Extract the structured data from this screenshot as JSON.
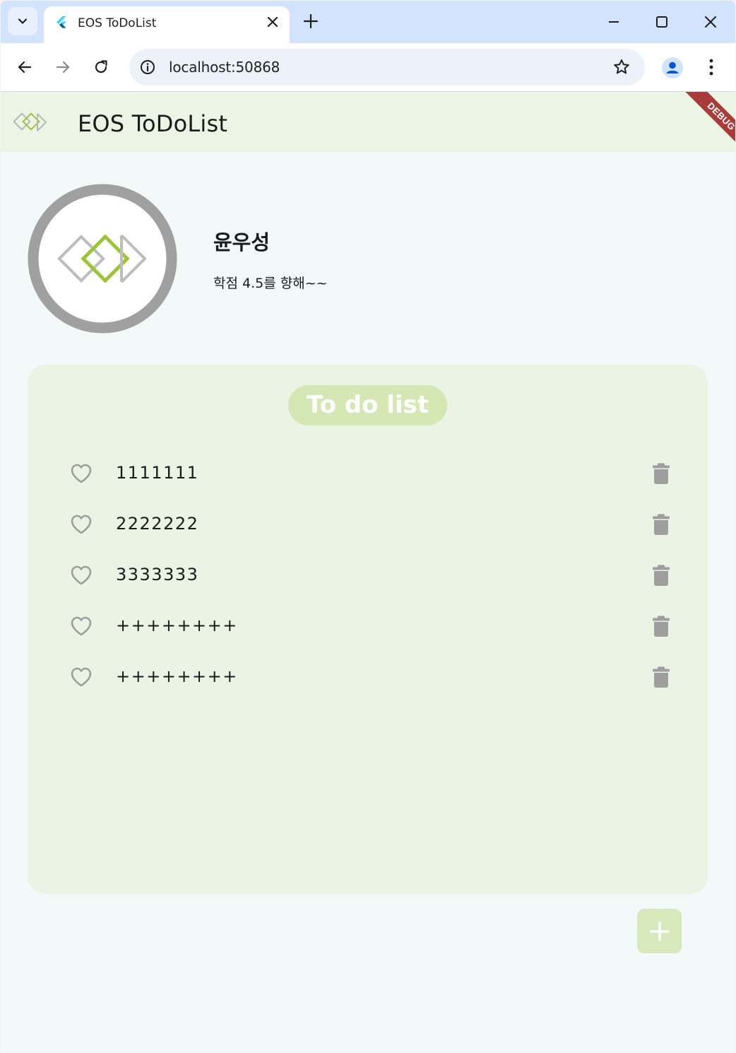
{
  "browser": {
    "tab_title": "EOS ToDoList",
    "url": "localhost:50868"
  },
  "app": {
    "title": "EOS ToDoList",
    "debug_banner": "DEBUG"
  },
  "profile": {
    "name": "윤우성",
    "status": "학점 4.5를 향해~~"
  },
  "todo": {
    "header": "To do list",
    "items": [
      {
        "text": "1111111",
        "favorite": false
      },
      {
        "text": "2222222",
        "favorite": false
      },
      {
        "text": "3333333",
        "favorite": false
      },
      {
        "text": "++++++++",
        "favorite": false
      },
      {
        "text": "++++++++",
        "favorite": false
      }
    ]
  },
  "colors": {
    "appbar": "#ecf4e5",
    "card": "#ebf3e4",
    "accent_green": "#9cc43a",
    "pill": "#d5e7b5",
    "icon_grey": "#9e9e9e",
    "debug_red": "#a83c3c"
  },
  "icons": {
    "tab_search": "chevron-down-icon",
    "close": "close-icon",
    "new_tab": "plus-icon",
    "back": "arrow-left-icon",
    "forward": "arrow-right-icon",
    "reload": "reload-icon",
    "info": "info-icon",
    "bookmark": "star-icon",
    "profile": "person-icon",
    "menu": "kebab-icon",
    "favorite": "heart-outline-icon",
    "delete": "trash-icon",
    "add": "plus-icon"
  }
}
